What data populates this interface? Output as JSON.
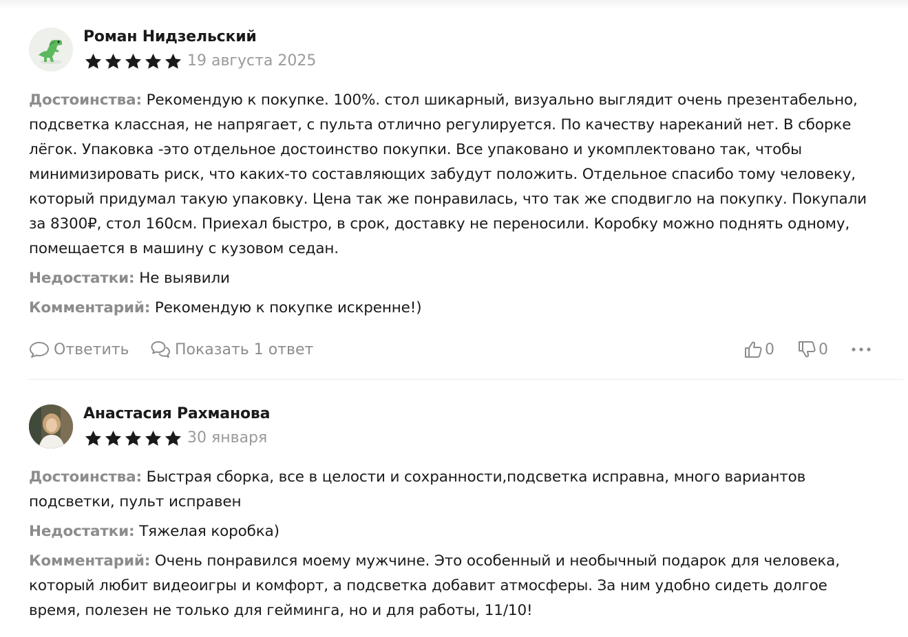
{
  "labels": {
    "pros": "Достоинства:",
    "cons": "Недостатки:",
    "comment": "Комментарий:"
  },
  "colors": {
    "label": "#8c8c8c",
    "star": "#1a1a1a",
    "muted": "#9a9a9a"
  },
  "reviews": [
    {
      "author": "Роман Нидзельский",
      "rating": 5,
      "date": "19 августа 2025",
      "avatar_icon": "dinosaur-avatar",
      "pros": "Рекомендую к покупке. 100%. стол шикарный, визуально выглядит очень презентабельно, подсветка классная, не напрягает, с пульта отлично регулируется. По качеству нареканий нет. В сборке лёгок. Упаковка -это отдельное достоинство покупки. Все упаковано и укомплектовано так, чтобы минимизировать риск, что каких-то составляющих забудут положить. Отдельное спасибо тому человеку, который придумал такую упаковку. Цена так же понравилась, что так же сподвигло на покупку. Покупали за 8300₽, стол 160см. Приехал быстро, в срок, доставку не переносили. Коробку можно поднять одному, помещается в машину с кузовом седан.",
      "cons": "Не выявили",
      "comment": "Рекомендую к покупке искренне!)",
      "actions": {
        "reply": "Ответить",
        "show_replies": "Показать 1 ответ",
        "likes": "0",
        "dislikes": "0"
      }
    },
    {
      "author": "Анастасия Рахманова",
      "rating": 5,
      "date": "30 января",
      "avatar_icon": "user-photo-avatar",
      "pros": "Быстрая сборка, все в целости и сохранности,подсветка исправна, много вариантов подсветки, пульт исправен",
      "cons": "Тяжелая коробка)",
      "comment": "Очень понравился моему мужчине. Это особенный и необычный подарок для человека, который любит видеоигры и комфорт, а подсветка добавит атмосферы. За ним удобно сидеть долгое время, полезен не только для гейминга, но и для работы, 11/10!"
    }
  ]
}
